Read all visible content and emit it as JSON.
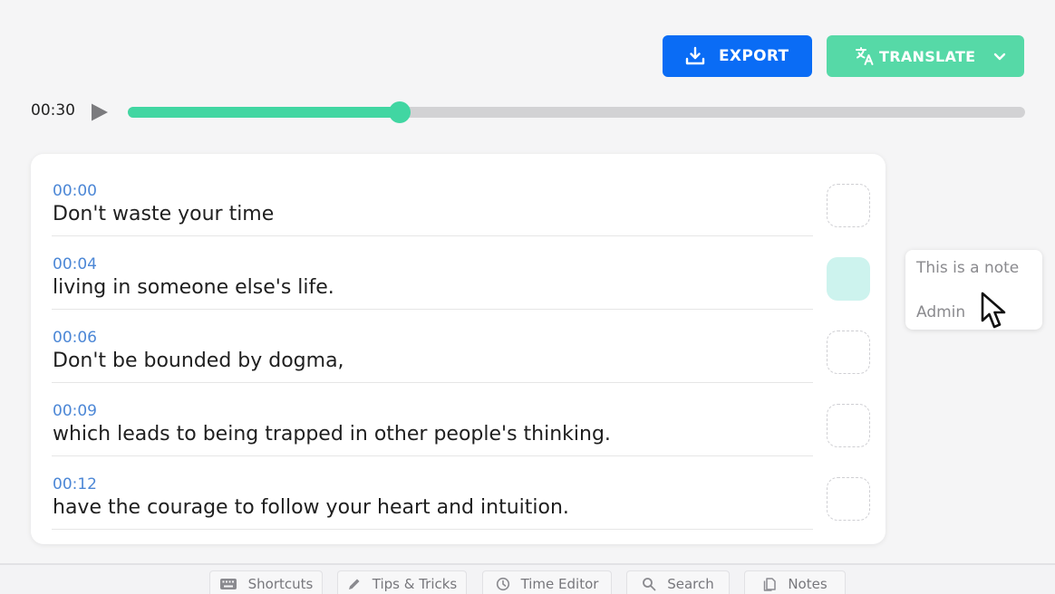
{
  "toolbar": {
    "export_label": "EXPORT",
    "translate_label": "TRANSLATE",
    "export_color": "#0a6cf5",
    "translate_color": "#56d9a7"
  },
  "player": {
    "current_time": "00:30",
    "progress_fraction": 0.303,
    "accent_color": "#41d6a2"
  },
  "transcript": {
    "segments": [
      {
        "time": "00:00",
        "text": "Don't waste your time",
        "has_note": false
      },
      {
        "time": "00:04",
        "text": "living in someone else's life.",
        "has_note": true
      },
      {
        "time": "00:06",
        "text": "Don't be bounded by dogma,",
        "has_note": false
      },
      {
        "time": "00:09",
        "text": "which leads to being trapped in other people's thinking.",
        "has_note": false
      },
      {
        "time": "00:12",
        "text": "have the courage to follow your heart and intuition.",
        "has_note": false
      }
    ]
  },
  "note": {
    "text": "This is a note",
    "author": "Admin"
  },
  "bottom_tabs": [
    {
      "label": "Shortcuts",
      "icon": "keyboard-icon"
    },
    {
      "label": "Tips & Tricks",
      "icon": "pencil-icon"
    },
    {
      "label": "Time Editor",
      "icon": "clock-icon"
    },
    {
      "label": "Search",
      "icon": "search-icon"
    },
    {
      "label": "Notes",
      "icon": "notes-icon"
    }
  ]
}
